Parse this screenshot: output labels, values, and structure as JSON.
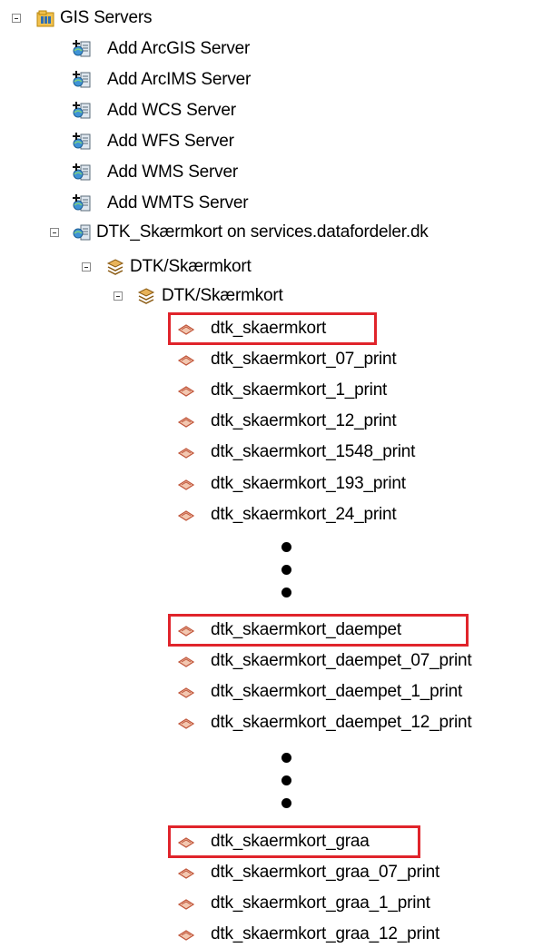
{
  "tree": {
    "root_label": "GIS Servers",
    "add_items": [
      "Add ArcGIS Server",
      "Add ArcIMS Server",
      "Add WCS Server",
      "Add WFS Server",
      "Add WMS Server",
      "Add WMTS Server"
    ],
    "server_label": "DTK_Skærmkort on services.datafordeler.dk",
    "service_label": "DTK/Skærmkort",
    "group_label": "DTK/Skærmkort",
    "layers_group_1": [
      "dtk_skaermkort",
      "dtk_skaermkort_07_print",
      "dtk_skaermkort_1_print",
      "dtk_skaermkort_12_print",
      "dtk_skaermkort_1548_print",
      "dtk_skaermkort_193_print",
      "dtk_skaermkort_24_print"
    ],
    "layers_group_2": [
      "dtk_skaermkort_daempet",
      "dtk_skaermkort_daempet_07_print",
      "dtk_skaermkort_daempet_1_print",
      "dtk_skaermkort_daempet_12_print"
    ],
    "layers_group_3": [
      "dtk_skaermkort_graa",
      "dtk_skaermkort_graa_07_print",
      "dtk_skaermkort_graa_1_print",
      "dtk_skaermkort_graa_12_print"
    ]
  },
  "icons": {
    "gis_servers": "server-folder-icon",
    "add_server": "add-server-icon",
    "server_connection": "server-connection-icon",
    "service": "layer-stack-icon",
    "layer": "map-layer-icon"
  },
  "colors": {
    "highlight": "#e0242b"
  }
}
